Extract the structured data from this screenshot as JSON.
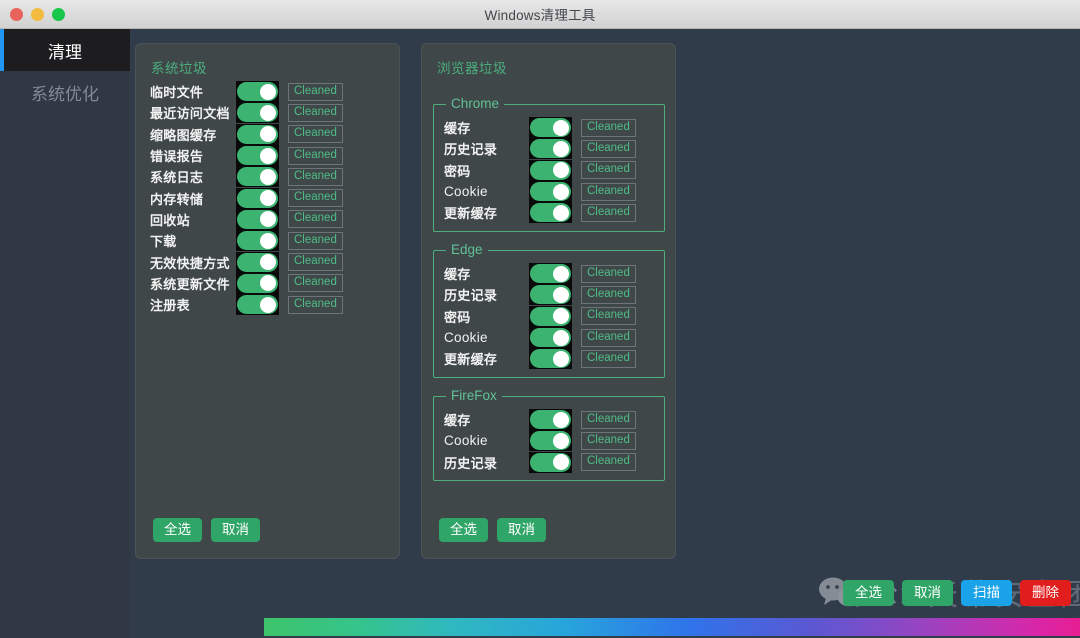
{
  "window": {
    "title": "Windows清理工具",
    "controls": [
      "close",
      "minimize",
      "maximize"
    ]
  },
  "sidebar": {
    "items": [
      {
        "label": "清理",
        "active": true
      },
      {
        "label": "系统优化",
        "active": false
      }
    ]
  },
  "system_panel": {
    "title": "系统垃圾",
    "status_label": "Cleaned",
    "rows": [
      {
        "label": "临时文件",
        "enabled": true,
        "status": "Cleaned"
      },
      {
        "label": "最近访问文档",
        "enabled": true,
        "status": "Cleaned"
      },
      {
        "label": "缩略图缓存",
        "enabled": true,
        "status": "Cleaned"
      },
      {
        "label": "错误报告",
        "enabled": true,
        "status": "Cleaned"
      },
      {
        "label": "系统日志",
        "enabled": true,
        "status": "Cleaned"
      },
      {
        "label": "内存转储",
        "enabled": true,
        "status": "Cleaned"
      },
      {
        "label": "回收站",
        "enabled": true,
        "status": "Cleaned"
      },
      {
        "label": "下载",
        "enabled": true,
        "status": "Cleaned"
      },
      {
        "label": "无效快捷方式",
        "enabled": true,
        "status": "Cleaned"
      },
      {
        "label": "系统更新文件",
        "enabled": true,
        "status": "Cleaned"
      },
      {
        "label": "注册表",
        "enabled": true,
        "status": "Cleaned"
      }
    ],
    "select_all": "全选",
    "cancel": "取消"
  },
  "browser_panel": {
    "title": "浏览器垃圾",
    "groups": [
      {
        "name": "Chrome",
        "rows": [
          {
            "label": "缓存",
            "latin": false,
            "enabled": true,
            "status": "Cleaned"
          },
          {
            "label": "历史记录",
            "latin": false,
            "enabled": true,
            "status": "Cleaned"
          },
          {
            "label": "密码",
            "latin": false,
            "enabled": true,
            "status": "Cleaned"
          },
          {
            "label": "Cookie",
            "latin": true,
            "enabled": true,
            "status": "Cleaned"
          },
          {
            "label": "更新缓存",
            "latin": false,
            "enabled": true,
            "status": "Cleaned"
          }
        ]
      },
      {
        "name": "Edge",
        "rows": [
          {
            "label": "缓存",
            "latin": false,
            "enabled": true,
            "status": "Cleaned"
          },
          {
            "label": "历史记录",
            "latin": false,
            "enabled": true,
            "status": "Cleaned"
          },
          {
            "label": "密码",
            "latin": false,
            "enabled": true,
            "status": "Cleaned"
          },
          {
            "label": "Cookie",
            "latin": true,
            "enabled": true,
            "status": "Cleaned"
          },
          {
            "label": "更新缓存",
            "latin": false,
            "enabled": true,
            "status": "Cleaned"
          }
        ]
      },
      {
        "name": "FireFox",
        "rows": [
          {
            "label": "缓存",
            "latin": false,
            "enabled": true,
            "status": "Cleaned"
          },
          {
            "label": "Cookie",
            "latin": true,
            "enabled": true,
            "status": "Cleaned"
          },
          {
            "label": "历史记录",
            "latin": false,
            "enabled": true,
            "status": "Cleaned"
          }
        ]
      }
    ],
    "select_all": "全选",
    "cancel": "取消"
  },
  "bottom_actions": [
    {
      "label": "全选",
      "color": "#2fa567",
      "style": "green"
    },
    {
      "label": "取消",
      "color": "#2fa567",
      "style": "green"
    },
    {
      "label": "扫描",
      "color": "#1aa3e8",
      "style": "blue"
    },
    {
      "label": "删除",
      "color": "#e11d1d",
      "style": "red"
    }
  ],
  "watermark": {
    "icon": "wechat-icon",
    "label": "公众号",
    "brand": "天幕安全团队"
  },
  "colors": {
    "window_bg": "#313c4a",
    "panel_bg": "#3f4749",
    "sidebar_bg": "#2f3843",
    "accent_green": "#4caf7d",
    "toggle_on": "#3cb371",
    "active_indicator": "#2196f3",
    "danger": "#e11d1d",
    "info": "#1aa3e8"
  }
}
